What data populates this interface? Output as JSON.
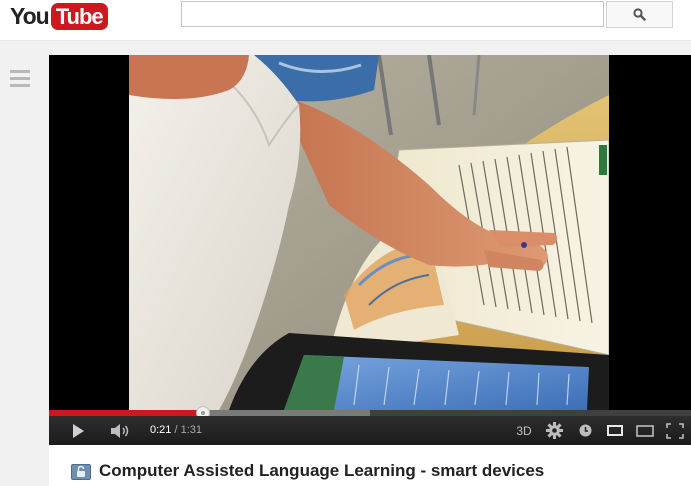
{
  "logo": {
    "you": "You",
    "tube": "Tube"
  },
  "search": {
    "value": "",
    "placeholder": ""
  },
  "player": {
    "current_time": "0:21",
    "separator": "/",
    "duration": "1:31",
    "played_fraction": 0.24,
    "loaded_fraction": 0.5,
    "label_3d": "3D",
    "icons": {
      "play": "play-icon",
      "volume": "volume-icon",
      "settings": "gear-icon",
      "watch_later": "clock-icon",
      "small_player": "small-player-icon",
      "large_player": "large-player-icon",
      "fullscreen": "fullscreen-icon"
    },
    "colors": {
      "progress": "#cc181e",
      "control_bar": "#1b1b1b"
    }
  },
  "video": {
    "title": "Computer Assisted Language Learning - smart devices",
    "privacy_icon": "unlisted-lock-icon"
  },
  "colors": {
    "brand": "#cc181e",
    "page_bg": "#f1f1f1"
  }
}
